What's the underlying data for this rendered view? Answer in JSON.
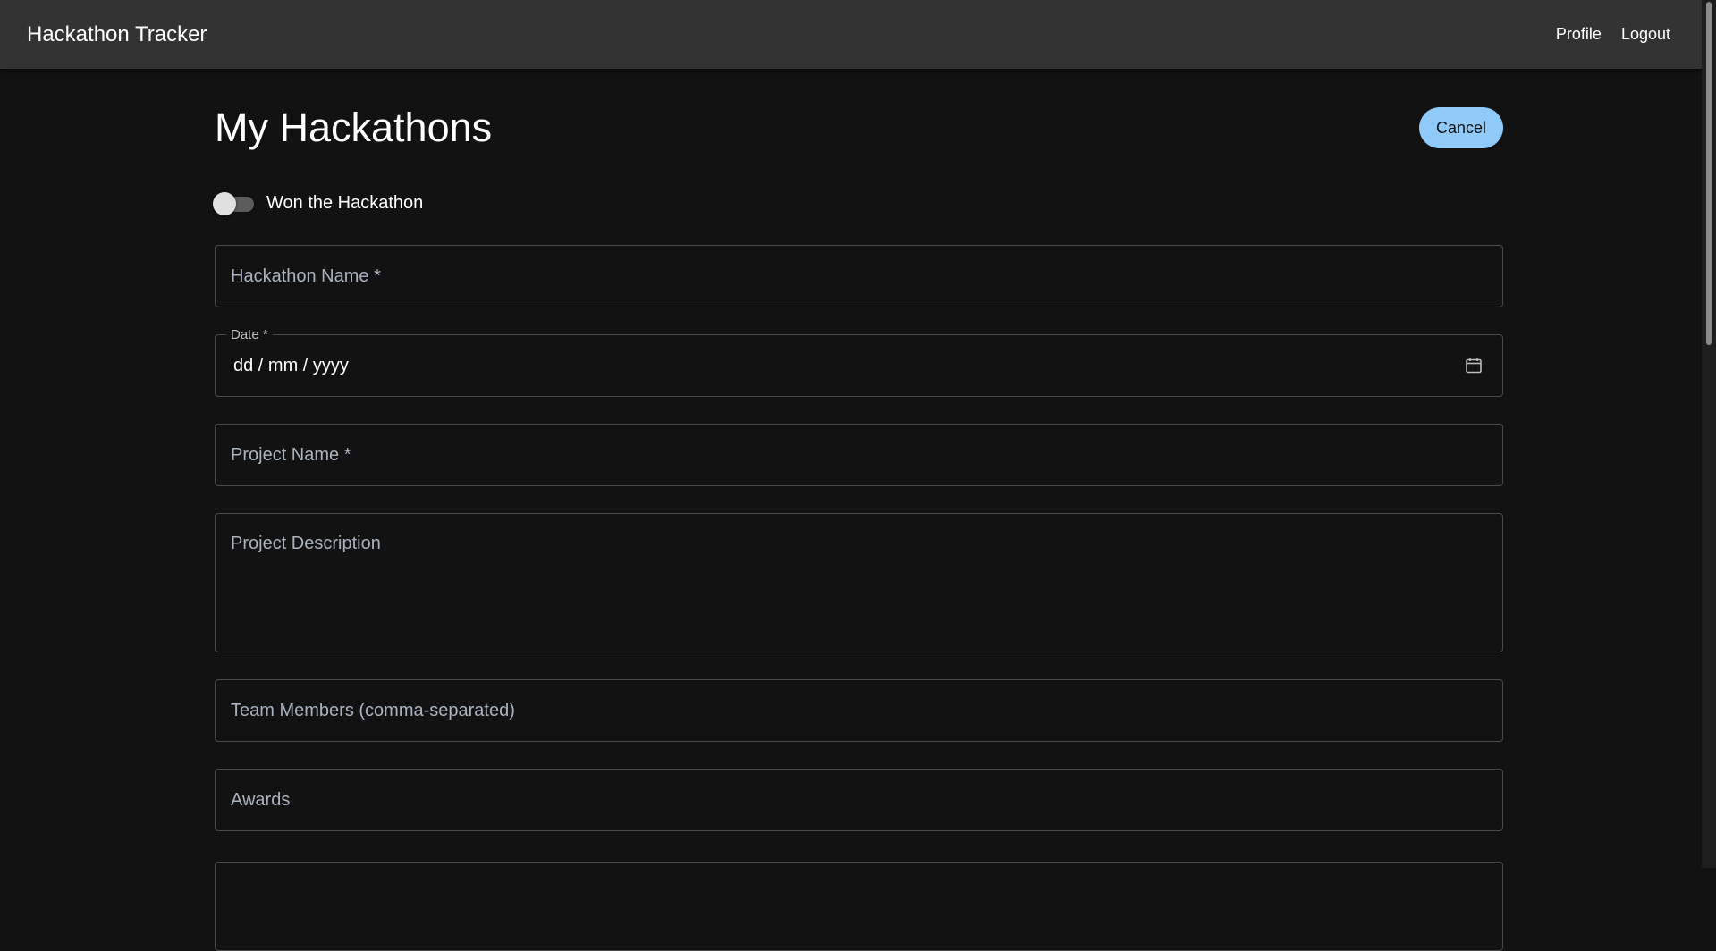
{
  "appbar": {
    "title": "Hackathon Tracker",
    "nav": {
      "profile_label": "Profile",
      "logout_label": "Logout"
    }
  },
  "page": {
    "title": "My Hackathons",
    "cancel_label": "Cancel"
  },
  "form": {
    "won_toggle": {
      "label": "Won the Hackathon",
      "checked": false
    },
    "hackathon_name": {
      "placeholder": "Hackathon Name *"
    },
    "date": {
      "legend": "Date *",
      "value": "dd / mm / yyyy",
      "icon": "calendar-icon"
    },
    "project_name": {
      "placeholder": "Project Name *"
    },
    "project_description": {
      "placeholder": "Project Description"
    },
    "team_members": {
      "placeholder": "Team Members (comma-separated)"
    },
    "awards": {
      "placeholder": "Awards"
    }
  },
  "colors": {
    "background": "#121212",
    "appbar": "#333333",
    "accent": "#90caf9",
    "border": "#4a4a4a",
    "placeholder": "#a9b3bf"
  }
}
